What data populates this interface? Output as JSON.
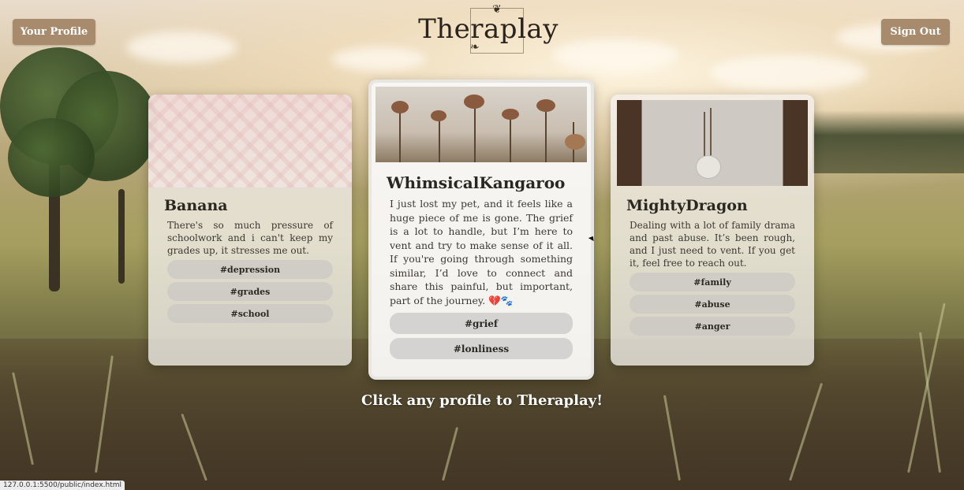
{
  "header": {
    "your_profile_label": "Your Profile",
    "sign_out_label": "Sign Out",
    "logo_text": "Theraplay"
  },
  "cards": [
    {
      "username": "Banana",
      "description": "There's so much pressure of schoolwork and i can't keep my grades up, it stresses me out.",
      "tags": [
        "#depression",
        "#grades",
        "#school"
      ]
    },
    {
      "username": "WhimsicalKangaroo",
      "description": "I just lost my pet, and it feels like a huge piece of me is gone. The grief is a lot to handle, but I’m here to vent and try to make sense of it all. If you're going through something similar, I’d love to connect and share this painful, but important, part of the journey. 💔🐾",
      "tags": [
        "#grief",
        "#lonliness"
      ]
    },
    {
      "username": "MightyDragon",
      "description": "Dealing with a lot of family drama and past abuse. It’s been rough, and I just need to vent. If you get it, feel free to reach out.",
      "tags": [
        "#family",
        "#abuse",
        "#anger"
      ]
    }
  ],
  "cta_text": "Click any profile to Theraplay!",
  "status_url": "127.0.0.1:5500/public/index.html",
  "colors": {
    "button": "#a88a6c",
    "card_bg": "#f3f0ec",
    "tag_bg": "#c8c6c3"
  }
}
